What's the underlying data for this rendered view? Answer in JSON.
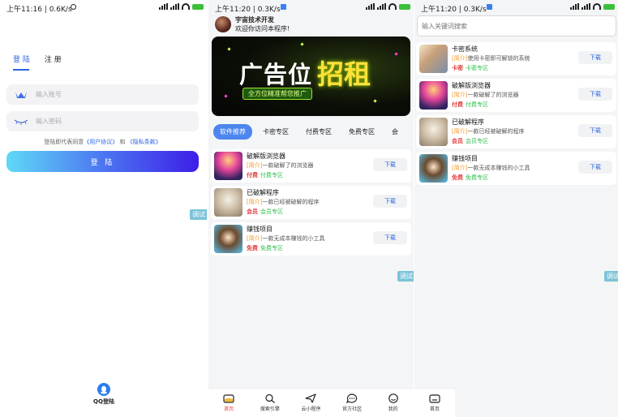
{
  "screen1": {
    "status": {
      "time": "上午11:16 | 0.6K/s"
    },
    "tabs": {
      "login": "登 陆",
      "register": "注 册"
    },
    "account": {
      "placeholder": "输入账号"
    },
    "password": {
      "placeholder": "输入密码"
    },
    "agree": {
      "prefix": "登陆即代表同意",
      "user_agreement": "《用户协议》",
      "and": "和",
      "privacy": "《隐私条款》"
    },
    "login_button": "登 陆",
    "qq_login": "QQ登陆",
    "debug": "调试"
  },
  "screen2": {
    "status": {
      "time": "上午11:20 | 0.3K/s"
    },
    "user": {
      "name": "宇宙技术开发",
      "greeting": "欢迎你访问本程序!"
    },
    "banner": {
      "text1": "广告位",
      "text2": "招租",
      "slogan": "全方位精准帮您推广"
    },
    "categories": [
      "软件推荐",
      "卡密专区",
      "付费专区",
      "免费专区",
      "会"
    ],
    "items": [
      {
        "title": "破解版浏览器",
        "prefix": "[简介]",
        "desc": "一款破解了的浏览器",
        "tag": "付费",
        "zone": "付费专区",
        "button": "下载"
      },
      {
        "title": "已破解程序",
        "prefix": "[简介]",
        "desc": "一款已经被破解的程序",
        "tag": "会员",
        "zone": "会员专区",
        "button": "下载"
      },
      {
        "title": "赚钱项目",
        "prefix": "[简介]",
        "desc": "一款无成本赚钱的小工具",
        "tag": "免费",
        "zone": "免费专区",
        "button": "下载"
      }
    ],
    "debug": "调试",
    "tabbar": [
      "首页",
      "搜索引擎",
      "云小程序",
      "官方社区",
      "我的"
    ]
  },
  "screen3": {
    "status": {
      "time": "上午11:20 | 0.3K/s"
    },
    "search": {
      "placeholder": "输入关键词搜索"
    },
    "items": [
      {
        "title": "卡密系统",
        "prefix": "[简介]",
        "desc": "使用卡密即可解锁的系统",
        "tag": "卡密",
        "zone": "卡密专区",
        "button": "下载"
      },
      {
        "title": "破解版浏览器",
        "prefix": "[简介]",
        "desc": "一款破解了的浏览器",
        "tag": "付费",
        "zone": "付费专区",
        "button": "下载"
      },
      {
        "title": "已破解程序",
        "prefix": "[简介]",
        "desc": "一款已经被破解的程序",
        "tag": "会员",
        "zone": "会员专区",
        "button": "下载"
      },
      {
        "title": "赚钱项目",
        "prefix": "[简介]",
        "desc": "一款无成本赚钱的小工具",
        "tag": "免费",
        "zone": "免费专区",
        "button": "下载"
      }
    ],
    "debug": "调试",
    "tabbar": [
      "首页"
    ]
  },
  "colors": {
    "accent": "#2c64e0",
    "tab_active": "#4c86ee",
    "price_red": "#e43b3b",
    "zone_green": "#2cbf4a",
    "intro_orange": "#f5972a"
  }
}
